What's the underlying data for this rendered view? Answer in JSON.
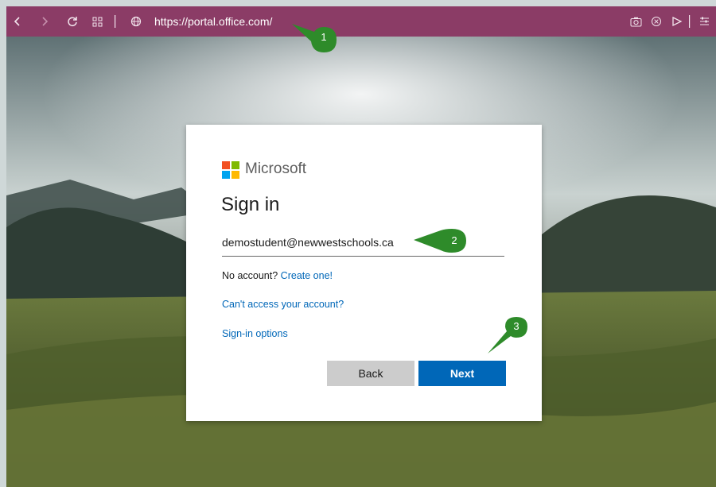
{
  "browser": {
    "url": "https://portal.office.com/",
    "accent": "#8b3c66",
    "icons": [
      "back-icon",
      "forward-icon",
      "refresh-icon",
      "apps-grid-icon",
      "globe-icon",
      "camera-icon",
      "close-circle-icon",
      "send-icon",
      "menu-icon"
    ]
  },
  "signin": {
    "brand": "Microsoft",
    "title": "Sign in",
    "email_value": "demostudent@newwestschools.ca",
    "no_account_text": "No account?",
    "create_link": "Create one!",
    "cant_access_link": "Can't access your account?",
    "options_link": "Sign-in options",
    "back_label": "Back",
    "next_label": "Next",
    "colors": {
      "primary": "#0067b8",
      "secondary": "#cccccc"
    }
  },
  "callouts": [
    {
      "number": "1"
    },
    {
      "number": "2"
    },
    {
      "number": "3"
    }
  ]
}
